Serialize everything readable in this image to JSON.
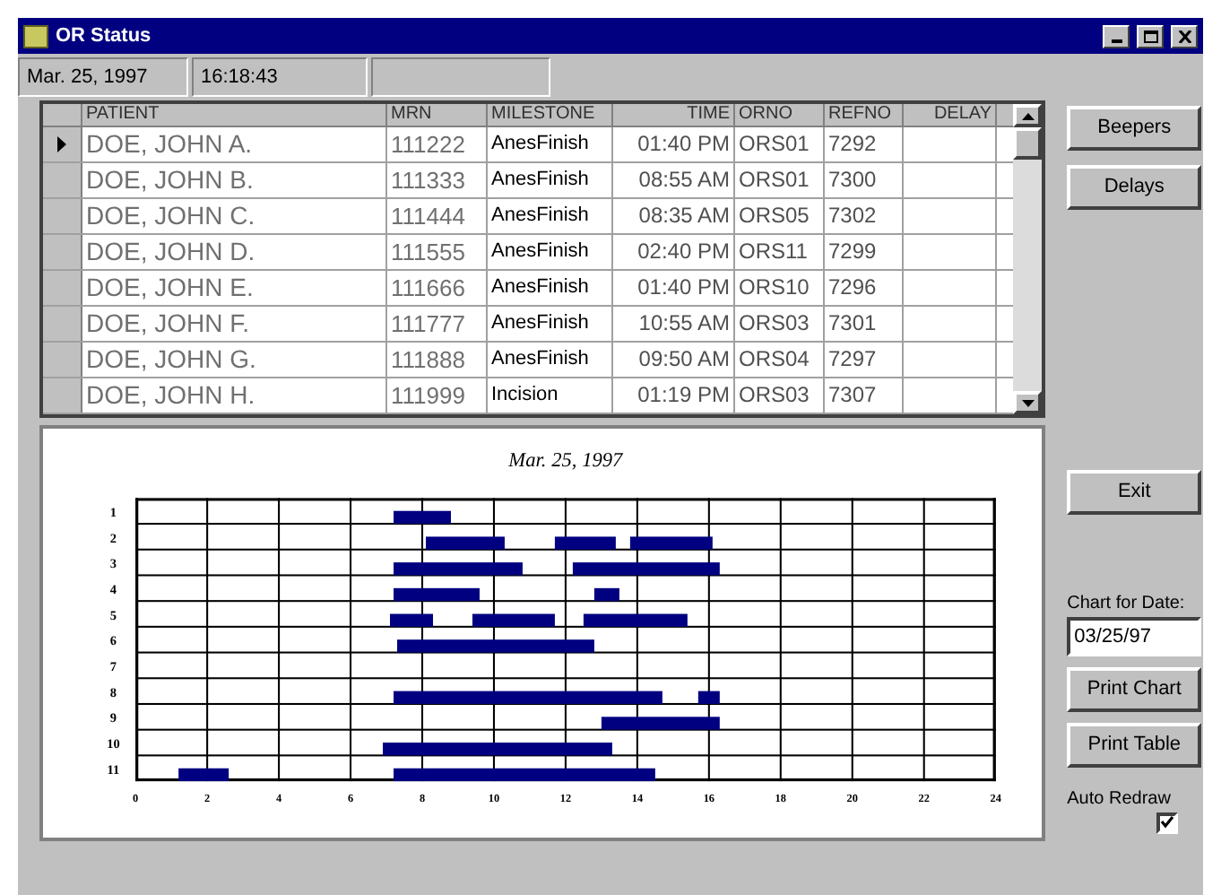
{
  "window": {
    "title": "OR Status"
  },
  "status_bar": {
    "date": "Mar. 25, 1997",
    "time": "16:18:43"
  },
  "table": {
    "columns": [
      "PATIENT",
      "MRN",
      "MILESTONE",
      "TIME",
      "ORNO",
      "REFNO",
      "DELAY"
    ],
    "rows": [
      {
        "selected": true,
        "cells": [
          "DOE, JOHN A.",
          "111222",
          "AnesFinish",
          "01:40 PM",
          "ORS01",
          "7292"
        ]
      },
      {
        "selected": false,
        "cells": [
          "DOE, JOHN B.",
          "111333",
          "AnesFinish",
          "08:55 AM",
          "ORS01",
          "7300"
        ]
      },
      {
        "selected": false,
        "cells": [
          "DOE, JOHN C.",
          "111444",
          "AnesFinish",
          "08:35 AM",
          "ORS05",
          "7302"
        ]
      },
      {
        "selected": false,
        "cells": [
          "DOE, JOHN D.",
          "111555",
          "AnesFinish",
          "02:40 PM",
          "ORS11",
          "7299"
        ]
      },
      {
        "selected": false,
        "cells": [
          "DOE, JOHN E.",
          "111666",
          "AnesFinish",
          "01:40 PM",
          "ORS10",
          "7296"
        ]
      },
      {
        "selected": false,
        "cells": [
          "DOE, JOHN F.",
          "111777",
          "AnesFinish",
          "10:55 AM",
          "ORS03",
          "7301"
        ]
      },
      {
        "selected": false,
        "cells": [
          "DOE, JOHN G.",
          "111888",
          "AnesFinish",
          "09:50 AM",
          "ORS04",
          "7297"
        ]
      },
      {
        "selected": false,
        "cells": [
          "DOE, JOHN H.",
          "111999",
          "Incision",
          "01:19 PM",
          "ORS03",
          "7307"
        ]
      }
    ]
  },
  "chart": {
    "title": "Mar. 25, 1997",
    "row_labels": [
      "1",
      "2",
      "3",
      "4",
      "5",
      "6",
      "7",
      "8",
      "9",
      "10",
      "11"
    ],
    "x_labels": [
      "0",
      "2",
      "4",
      "6",
      "8",
      "10",
      "12",
      "14",
      "16",
      "18",
      "20",
      "22",
      "24"
    ]
  },
  "side": {
    "top_buttons": [
      "Beepers",
      "Delays"
    ],
    "exit": "Exit",
    "date_label": "Chart for Date:",
    "date_value": "03/25/97",
    "print_buttons": [
      "Print Chart",
      "Print Table"
    ],
    "auto_redraw": {
      "label": "Auto Redraw",
      "checked": true
    }
  }
}
